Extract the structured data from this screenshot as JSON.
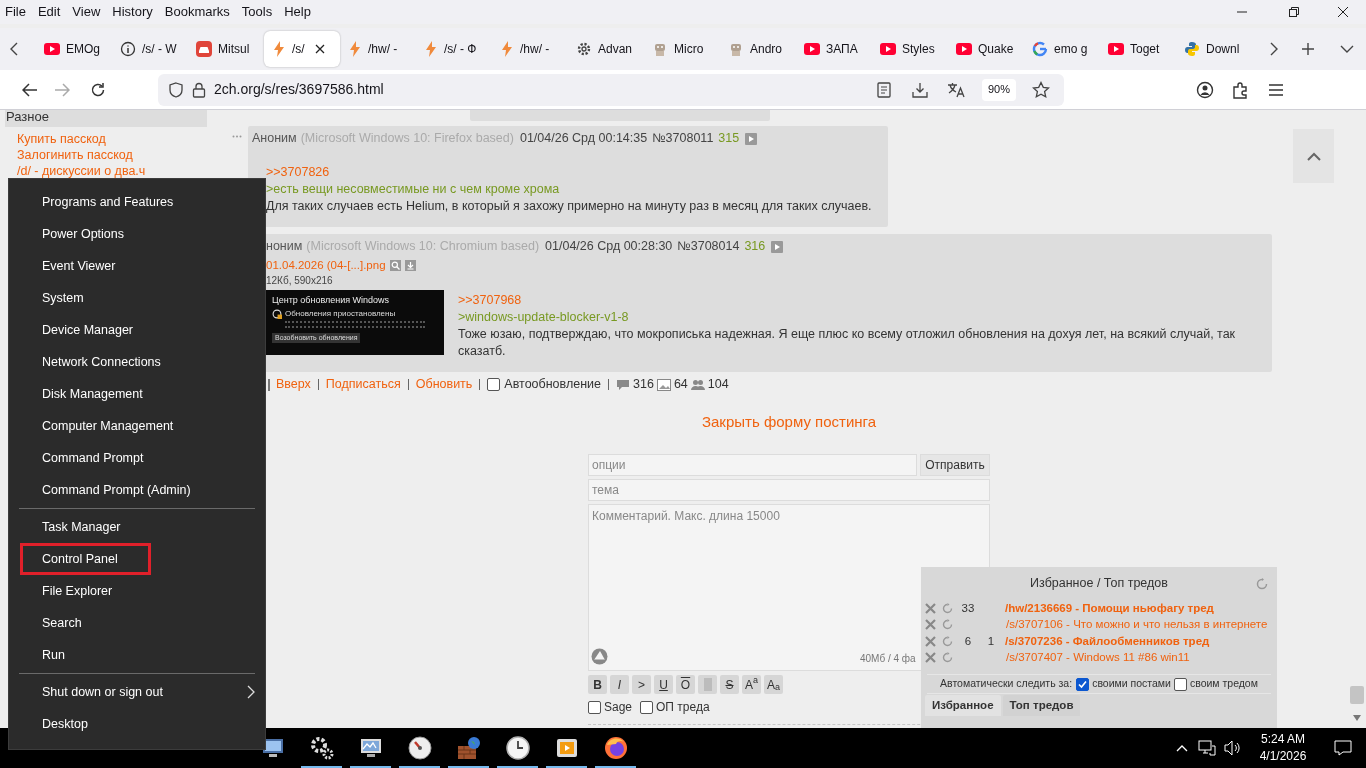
{
  "menubar": [
    "File",
    "Edit",
    "View",
    "History",
    "Bookmarks",
    "Tools",
    "Help"
  ],
  "tabs": [
    {
      "title": "EMOg",
      "kind": "youtube",
      "selected": false
    },
    {
      "title": "/s/ - W",
      "kind": "info",
      "selected": false
    },
    {
      "title": "Mitsul",
      "kind": "car",
      "selected": false
    },
    {
      "title": "/s/",
      "kind": "bolt",
      "selected": true
    },
    {
      "title": "/hw/ -",
      "kind": "bolt",
      "selected": false
    },
    {
      "title": "/s/ - Ф",
      "kind": "bolt",
      "selected": false
    },
    {
      "title": "/hw/ -",
      "kind": "bolt",
      "selected": false
    },
    {
      "title": "Advan",
      "kind": "gear",
      "selected": false
    },
    {
      "title": "Micro",
      "kind": "robot",
      "selected": false
    },
    {
      "title": "Andro",
      "kind": "robot",
      "selected": false
    },
    {
      "title": "ЗАПА",
      "kind": "youtube",
      "selected": false
    },
    {
      "title": "Styles",
      "kind": "youtube",
      "selected": false
    },
    {
      "title": "Quake",
      "kind": "youtube",
      "selected": false
    },
    {
      "title": "emo g",
      "kind": "google",
      "selected": false
    },
    {
      "title": "Toget",
      "kind": "youtube",
      "selected": false
    },
    {
      "title": "Downl",
      "kind": "python",
      "selected": false
    }
  ],
  "address_bar": {
    "url": "2ch.org/s/res/3697586.html",
    "zoom": "90%"
  },
  "sidebar": {
    "heading": "Разное",
    "links": [
      "Купить пасскод",
      "Залогинить пасскод",
      "/d/ - дискуссии о два.ч"
    ]
  },
  "posts": [
    {
      "author": "Аноним",
      "useragent": "(Microsoft Windows 10: Firefox based)",
      "datetime": "01/04/26 Срд 00:14:35",
      "number": "№3708011",
      "index": "315",
      "body": [
        {
          "kind": "reply",
          "text": ">>3707826"
        },
        {
          "kind": "quote",
          "text": ">есть вещи несовместимые ни с чем кроме хрома"
        },
        {
          "kind": "text",
          "text": "Для таких случаев есть Helium, в который я захожу примерно на минуту раз в месяц для таких случаев."
        }
      ]
    },
    {
      "author": "ноним",
      "useragent": "(Microsoft Windows 10: Chromium based)",
      "datetime": "01/04/26 Срд 00:28:30",
      "number": "№3708014",
      "index": "316",
      "file": {
        "name": "01.04.2026 (04-[...].png",
        "meta": "12Кб, 590x216",
        "shot_title": "Центр обновления Windows",
        "shot_heading": "Обновления приостановлены",
        "shot_button": "Возобновить обновления"
      },
      "body": [
        {
          "kind": "reply",
          "text": ">>3707968"
        },
        {
          "kind": "quote",
          "text": ">windows-update-blocker-v1-8"
        },
        {
          "kind": "text",
          "text": "Тоже юзаю, подтверждаю, что мокрописька надежная. Я еще плюс ко всему отложил обновления на дохуя лет, на всякий случай, так сказатб."
        }
      ]
    }
  ],
  "thread_nav": {
    "links": [
      "Вверх",
      "Подписаться",
      "Обновить"
    ],
    "autoupdate": {
      "label": "Автообновление",
      "checked": false
    },
    "posts_count": "316",
    "images_count": "64",
    "posters_count": "104"
  },
  "close_form": "Закрыть форму постинга",
  "form": {
    "options_placeholder": "опции",
    "submit": "Отправить",
    "subject_placeholder": "тема",
    "comment_placeholder": "Комментарий. Макс. длина 15000",
    "limits": "40Мб / 4 фа",
    "markup_buttons": [
      {
        "kind": "bold",
        "label": "B"
      },
      {
        "kind": "italic",
        "label": "I"
      },
      {
        "kind": "quote",
        "label": ">"
      },
      {
        "kind": "underline",
        "label": "U"
      },
      {
        "kind": "overline",
        "label": "O"
      },
      {
        "kind": "spoiler"
      },
      {
        "kind": "strike",
        "label": "S"
      },
      {
        "kind": "sup",
        "label": "A$^{a}$"
      },
      {
        "kind": "sub",
        "label": "A$_{a}$"
      }
    ],
    "checkboxes": [
      {
        "label": "Sage",
        "checked": false
      },
      {
        "label": "ОП треда",
        "checked": false
      }
    ]
  },
  "favorites": {
    "title": "Избранное / Топ тредов",
    "rows": [
      {
        "new_posts": "33",
        "link": "/hw/2136669 - Помощи ньюфагу тред",
        "has_new": true
      },
      {
        "link": "/s/3707106 - Что можно и что нельзя в интернете",
        "has_new": false
      },
      {
        "new_posts": "6",
        "replies": "1",
        "link": "/s/3707236 - Файлообменников тред",
        "has_new": true
      },
      {
        "link": "/s/3707407 - Windows 11 #86 win11",
        "has_new": false
      }
    ],
    "autofollow_label": "Автоматически следить за:",
    "autofollow": [
      {
        "label": "своими постами",
        "checked": true
      },
      {
        "label": "своим тредом",
        "checked": false
      }
    ],
    "tabs": [
      {
        "label": "Избранное",
        "selected": true
      },
      {
        "label": "Топ тредов",
        "selected": false
      }
    ]
  },
  "winx_menu": {
    "groups": [
      [
        {
          "label": "Programs and Features",
          "highlighted": false
        },
        {
          "label": "Power Options",
          "highlighted": false
        },
        {
          "label": "Event Viewer",
          "highlighted": false
        },
        {
          "label": "System",
          "highlighted": false
        },
        {
          "label": "Device Manager",
          "highlighted": false
        },
        {
          "label": "Network Connections",
          "highlighted": false
        },
        {
          "label": "Disk Management",
          "highlighted": false
        },
        {
          "label": "Computer Management",
          "highlighted": false
        },
        {
          "label": "Command Prompt",
          "highlighted": false
        },
        {
          "label": "Command Prompt (Admin)",
          "highlighted": false
        }
      ],
      [
        {
          "label": "Task Manager",
          "highlighted": false
        },
        {
          "label": "Control Panel",
          "highlighted": true
        },
        {
          "label": "File Explorer",
          "highlighted": false
        },
        {
          "label": "Search",
          "highlighted": false
        },
        {
          "label": "Run",
          "highlighted": false
        }
      ],
      [
        {
          "label": "Shut down or sign out",
          "highlighted": false,
          "submenu": true
        },
        {
          "label": "Desktop",
          "highlighted": false
        }
      ]
    ]
  },
  "taskbar": {
    "apps": [
      {
        "kind": "computer",
        "running": false
      },
      {
        "kind": "gear",
        "running": true
      },
      {
        "kind": "monitor",
        "running": true
      },
      {
        "kind": "dial",
        "running": true
      },
      {
        "kind": "globe",
        "running": true
      },
      {
        "kind": "clock",
        "running": true
      },
      {
        "kind": "player",
        "running": true
      },
      {
        "kind": "firefox",
        "running": true
      }
    ],
    "time": "5:24 AM",
    "date": "4/1/2026"
  }
}
